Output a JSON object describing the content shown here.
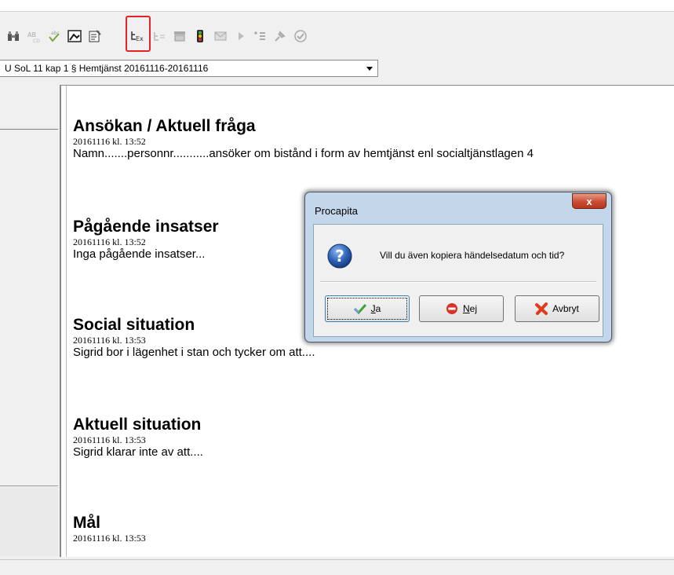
{
  "toolbar": {
    "icons": [
      "binoculars-icon",
      "spellcheck-ab-icon",
      "abc-check-icon",
      "picture-icon",
      "properties-icon",
      "copy-date-icon",
      "paste-icon",
      "template-icon",
      "traffic-light-icon",
      "mail-icon",
      "play-icon",
      "insert-list-icon",
      "pin-icon",
      "check-circle-icon"
    ],
    "highlight_color": "#e32424"
  },
  "case_select": {
    "value": "U SoL 11 kap 1 § Hemtjänst 20161116-20161116"
  },
  "document": {
    "sections": [
      {
        "heading": "Ansökan / Aktuell fråga",
        "timestamp": "20161116 kl. 13:52",
        "body": "Namn.......personnr...........ansöker om bistånd i form av hemtjänst enl  socialtjänstlagen 4"
      },
      {
        "heading": "Pågående insatser",
        "timestamp": "20161116 kl. 13:52",
        "body": "Inga pågående insatser..."
      },
      {
        "heading": "Social situation",
        "timestamp": "20161116 kl. 13:53",
        "body": "Sigrid bor i lägenhet i stan och tycker om att...."
      },
      {
        "heading": "Aktuell situation",
        "timestamp": "20161116 kl. 13:53",
        "body": "Sigrid klarar inte av att...."
      },
      {
        "heading": "Mål",
        "timestamp": "20161116 kl. 13:53",
        "body": ""
      }
    ]
  },
  "dialog": {
    "title": "Procapita",
    "close_label": "x",
    "message": "Vill du även kopiera händelsedatum och tid?",
    "buttons": {
      "ja": {
        "mnemonic": "J",
        "rest": "a"
      },
      "nej": {
        "mnemonic": "N",
        "rest": "ej"
      },
      "avbryt": {
        "label": "Avbryt"
      }
    }
  }
}
